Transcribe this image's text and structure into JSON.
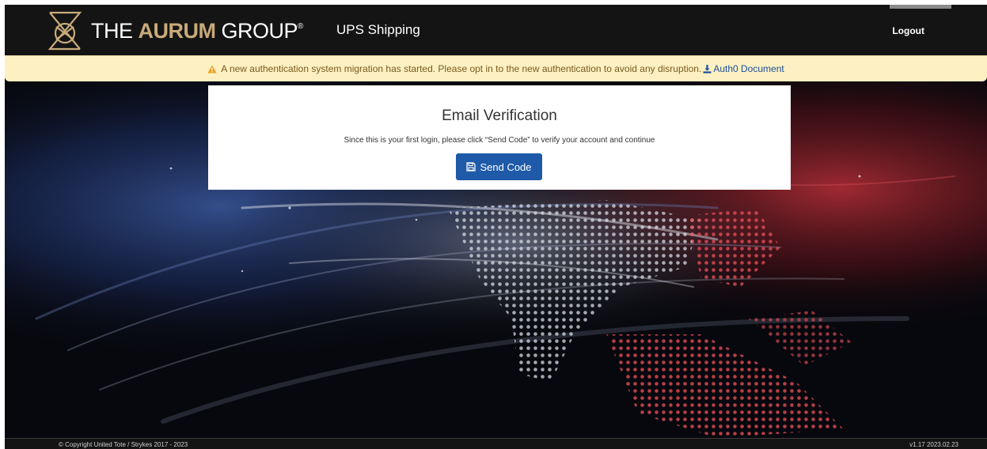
{
  "header": {
    "brand_prefix": "THE ",
    "brand_bold": "AURUM",
    "brand_suffix": " GROUP",
    "app_title": "UPS Shipping",
    "logout_label": "Logout"
  },
  "banner": {
    "message": "A new authentication system migration has started. Please opt in to the new authentication to avoid any disruption.",
    "link_label": "Auth0 Document",
    "icon": "warning-icon",
    "link_icon": "download-icon"
  },
  "card": {
    "title": "Email Verification",
    "subtitle": "Since this is your first login, please click “Send Code” to verify your account and continue",
    "button_label": "Send Code",
    "button_icon": "save-icon"
  },
  "footer": {
    "copyright": "© Copyright United Tote / Strykes 2017 - 2023",
    "version": "v1.17 2023.02.23"
  },
  "colors": {
    "navbar": "#141414",
    "brand_gold": "#c8aa7a",
    "banner_bg": "#fdf0c2",
    "banner_text": "#7a5a1e",
    "link": "#1a4f9c",
    "button": "#1e5aa8"
  }
}
